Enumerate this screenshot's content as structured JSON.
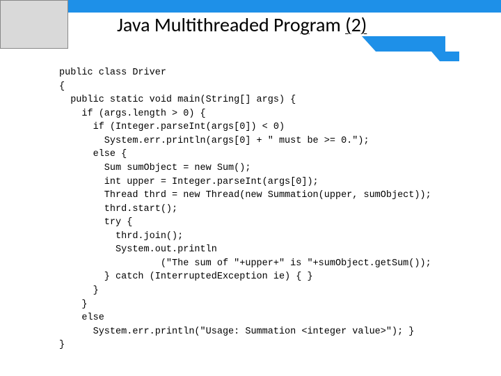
{
  "slide": {
    "title_plain": "Java Multithreaded Program (2)",
    "title_parts": {
      "p1": "Java Multithreaded Pro",
      "p2": "g",
      "p3": "ram ",
      "p4": "(",
      "p5": "2",
      "p6": ")"
    },
    "code": "public class Driver\n{\n  public static void main(String[] args) {\n    if (args.length > 0) {\n      if (Integer.parseInt(args[0]) < 0)\n        System.err.println(args[0] + \" must be >= 0.\");\n      else {\n        Sum sumObject = new Sum();\n        int upper = Integer.parseInt(args[0]);\n        Thread thrd = new Thread(new Summation(upper, sumObject));\n        thrd.start();\n        try {\n          thrd.join();\n          System.out.println\n                  (\"The sum of \"+upper+\" is \"+sumObject.getSum());\n        } catch (InterruptedException ie) { }\n      }\n    }\n    else\n      System.err.println(\"Usage: Summation <integer value>\"); }\n}"
  }
}
